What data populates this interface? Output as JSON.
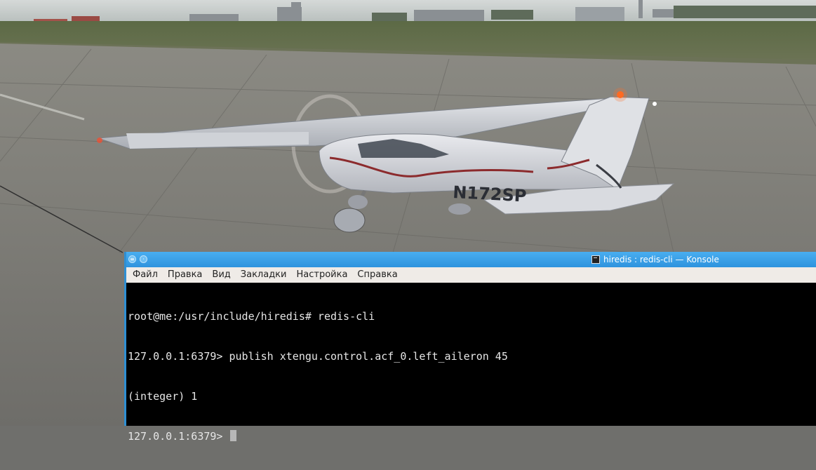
{
  "window": {
    "title": "hiredis : redis-cli — Konsole",
    "icons": {
      "menu": "window-menu-icon",
      "keep_above": "keep-above-icon",
      "app": "terminal-icon"
    }
  },
  "menubar": {
    "items": [
      "Файл",
      "Правка",
      "Вид",
      "Закладки",
      "Настройка",
      "Справка"
    ]
  },
  "terminal": {
    "lines": [
      "root@me:/usr/include/hiredis# redis-cli",
      "127.0.0.1:6379> publish xtengu.control.acf_0.left_aileron 45",
      "(integer) 1"
    ],
    "prompt": "127.0.0.1:6379> "
  },
  "scene": {
    "aircraft_registration": "N172SP"
  },
  "colors": {
    "titlebar": "#3a9fe6",
    "menubar": "#efebe7",
    "terminal_bg": "#000000",
    "terminal_fg": "#e6e6e6"
  }
}
